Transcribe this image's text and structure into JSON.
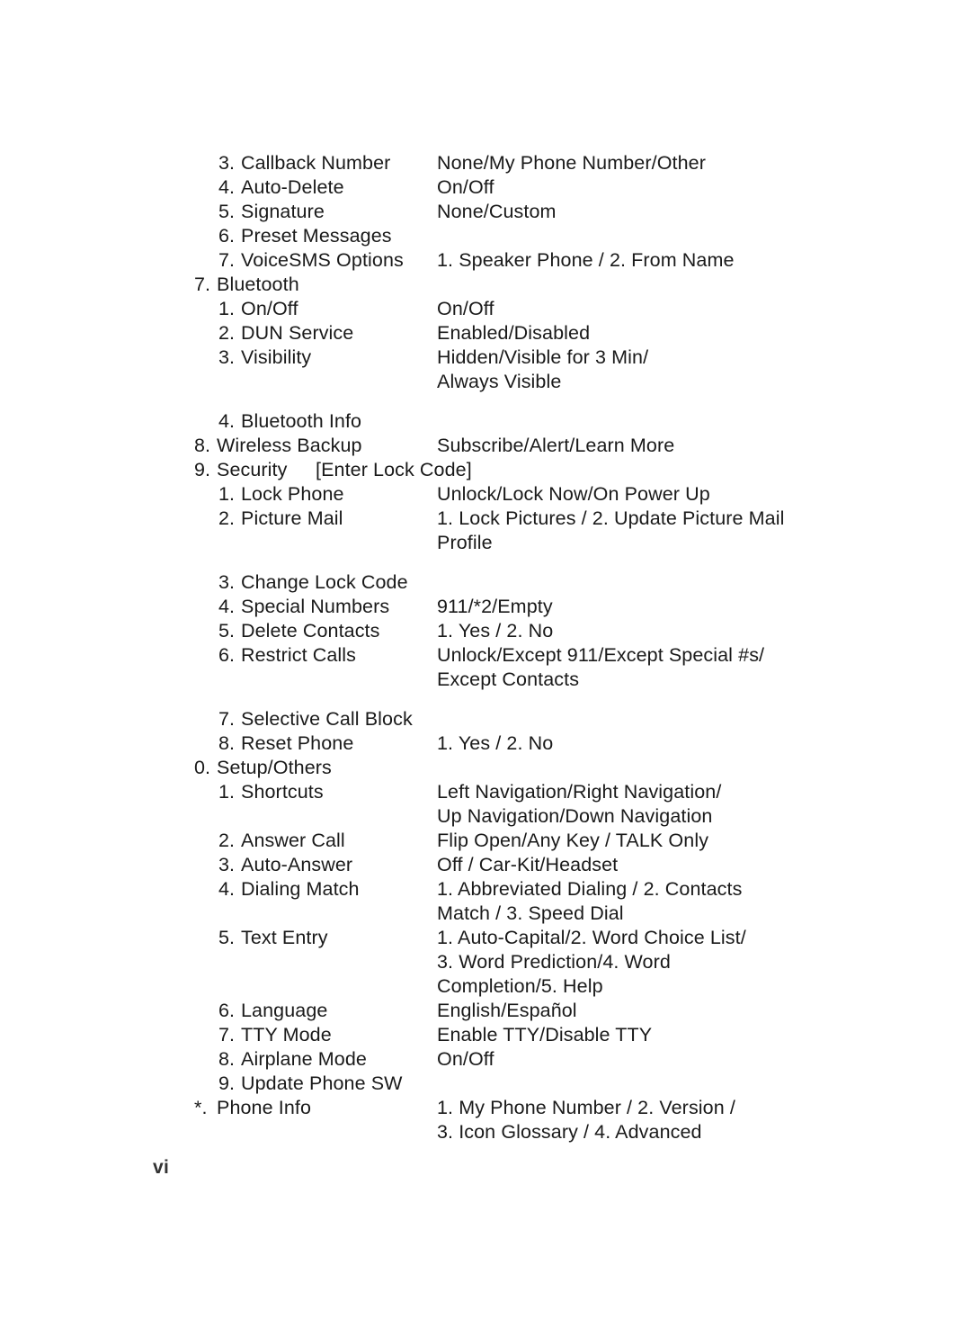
{
  "page": {
    "number": "vi"
  },
  "menu_rows": [
    {
      "level": 1,
      "num": "3.",
      "label": "Callback Number",
      "note": "",
      "value_lines": [
        "None/My Phone Number/Other"
      ],
      "after_wrap": false
    },
    {
      "level": 1,
      "num": "4.",
      "label": "Auto-Delete",
      "note": "",
      "value_lines": [
        "On/Off"
      ],
      "after_wrap": false
    },
    {
      "level": 1,
      "num": "5.",
      "label": "Signature",
      "note": "",
      "value_lines": [
        "None/Custom"
      ],
      "after_wrap": false
    },
    {
      "level": 1,
      "num": "6.",
      "label": "Preset Messages",
      "note": "",
      "value_lines": [],
      "after_wrap": false
    },
    {
      "level": 1,
      "num": "7.",
      "label": "VoiceSMS Options",
      "note": "",
      "value_lines": [
        "1. Speaker Phone / 2. From Name"
      ],
      "after_wrap": false
    },
    {
      "level": 0,
      "num": "7.",
      "label": "Bluetooth",
      "note": "",
      "value_lines": [],
      "after_wrap": false
    },
    {
      "level": 1,
      "num": "1.",
      "label": "On/Off",
      "note": "",
      "value_lines": [
        "On/Off"
      ],
      "after_wrap": false
    },
    {
      "level": 1,
      "num": "2.",
      "label": "DUN Service",
      "note": "",
      "value_lines": [
        "Enabled/Disabled"
      ],
      "after_wrap": false
    },
    {
      "level": 1,
      "num": "3.",
      "label": "Visibility",
      "note": "",
      "value_lines": [
        "Hidden/Visible for 3 Min/",
        "Always Visible"
      ],
      "after_wrap": false
    },
    {
      "level": 1,
      "num": "4.",
      "label": "Bluetooth Info",
      "note": "",
      "value_lines": [],
      "after_wrap": true
    },
    {
      "level": 0,
      "num": "8.",
      "label": "Wireless Backup",
      "note": "",
      "value_lines": [
        "Subscribe/Alert/Learn More"
      ],
      "after_wrap": false
    },
    {
      "level": 0,
      "num": "9.",
      "label": "Security",
      "note": "[Enter Lock Code]",
      "value_lines": [],
      "after_wrap": false
    },
    {
      "level": 1,
      "num": "1.",
      "label": "Lock Phone",
      "note": "",
      "value_lines": [
        "Unlock/Lock Now/On Power Up"
      ],
      "after_wrap": false
    },
    {
      "level": 1,
      "num": "2.",
      "label": "Picture Mail",
      "note": "",
      "value_lines": [
        "1. Lock Pictures / 2. Update Picture Mail",
        "Profile"
      ],
      "after_wrap": false
    },
    {
      "level": 1,
      "num": "3.",
      "label": "Change Lock Code",
      "note": "",
      "value_lines": [],
      "after_wrap": true
    },
    {
      "level": 1,
      "num": "4.",
      "label": "Special Numbers",
      "note": "",
      "value_lines": [
        "911/*2/Empty"
      ],
      "after_wrap": false
    },
    {
      "level": 1,
      "num": "5.",
      "label": "Delete Contacts",
      "note": "",
      "value_lines": [
        "1. Yes / 2. No"
      ],
      "after_wrap": false
    },
    {
      "level": 1,
      "num": "6.",
      "label": "Restrict Calls",
      "note": "",
      "value_lines": [
        "Unlock/Except 911/Except Special #s/",
        "Except Contacts"
      ],
      "after_wrap": false
    },
    {
      "level": 1,
      "num": "7.",
      "label": "Selective Call Block",
      "note": "",
      "value_lines": [],
      "after_wrap": true
    },
    {
      "level": 1,
      "num": "8.",
      "label": "Reset Phone",
      "note": "",
      "value_lines": [
        "1. Yes / 2. No"
      ],
      "after_wrap": false
    },
    {
      "level": 0,
      "num": "0.",
      "label": "Setup/Others",
      "note": "",
      "value_lines": [],
      "after_wrap": false
    },
    {
      "level": 1,
      "num": "1.",
      "label": "Shortcuts",
      "note": "",
      "value_lines": [
        "Left Navigation/Right Navigation/",
        "Up Navigation/Down Navigation"
      ],
      "after_wrap": false
    },
    {
      "level": 1,
      "num": "2.",
      "label": "Answer Call",
      "note": "",
      "value_lines": [
        "Flip Open/Any Key / TALK Only"
      ],
      "after_wrap": false
    },
    {
      "level": 1,
      "num": "3.",
      "label": "Auto-Answer",
      "note": "",
      "value_lines": [
        "Off / Car-Kit/Headset"
      ],
      "after_wrap": false
    },
    {
      "level": 1,
      "num": "4.",
      "label": "Dialing Match",
      "note": "",
      "value_lines": [
        "1. Abbreviated Dialing / 2. Contacts",
        "Match / 3. Speed Dial"
      ],
      "after_wrap": false
    },
    {
      "level": 1,
      "num": "5.",
      "label": "Text Entry",
      "note": "",
      "value_lines": [
        "1. Auto-Capital/2. Word Choice List/",
        "3. Word Prediction/4. Word",
        "Completion/5. Help"
      ],
      "after_wrap": false
    },
    {
      "level": 1,
      "num": "6.",
      "label": "Language",
      "note": "",
      "value_lines": [
        "English/Español"
      ],
      "after_wrap": false
    },
    {
      "level": 1,
      "num": "7.",
      "label": "TTY Mode",
      "note": "",
      "value_lines": [
        "Enable TTY/Disable TTY"
      ],
      "after_wrap": false
    },
    {
      "level": 1,
      "num": "8.",
      "label": "Airplane Mode",
      "note": "",
      "value_lines": [
        "On/Off"
      ],
      "after_wrap": false
    },
    {
      "level": 1,
      "num": "9.",
      "label": "Update Phone SW",
      "note": "",
      "value_lines": [],
      "after_wrap": false
    },
    {
      "level": 0,
      "num": "*.",
      "label": "Phone Info",
      "note": "",
      "value_lines": [
        "1. My Phone Number / 2. Version /",
        "3. Icon Glossary / 4. Advanced"
      ],
      "after_wrap": false
    }
  ]
}
